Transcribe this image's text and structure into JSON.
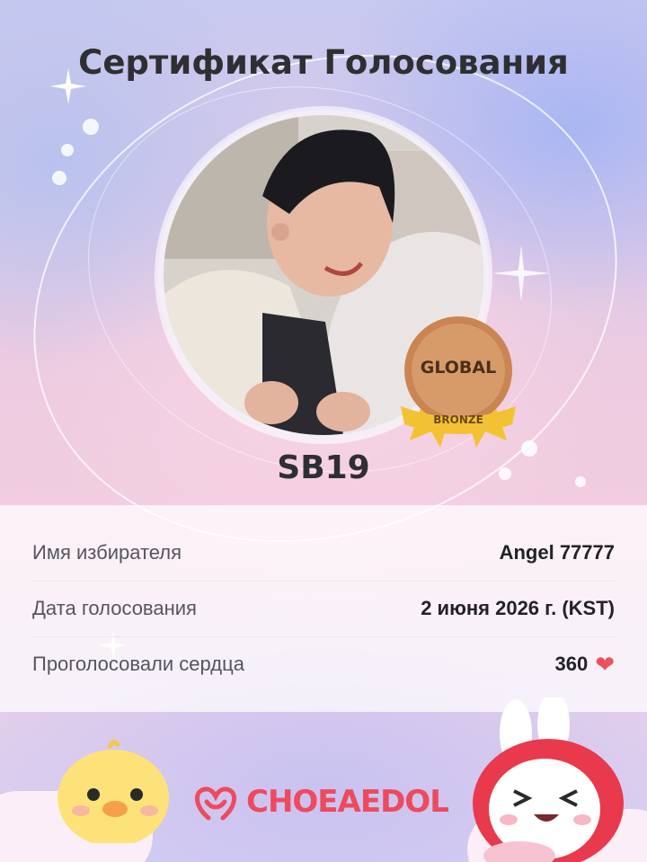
{
  "certificate": {
    "title": "Сертификат Голосования",
    "artist_name": "SB19",
    "badge": {
      "top_text": "GLOBAL",
      "ribbon_text": "BRONZE"
    }
  },
  "details": {
    "rows": [
      {
        "label": "Имя избирателя",
        "value": "Angel 77777"
      },
      {
        "label": "Дата голосования",
        "value": "2 июня 2026 г. (KST)"
      },
      {
        "label": "Проголосовали сердца",
        "value": "360"
      }
    ],
    "heart_icon": "heart-icon"
  },
  "brand": {
    "name": "CHOEAEDOL"
  },
  "colors": {
    "accent": "#ee4a5e",
    "heart": "#f0505e",
    "badge_bronze": "#d79b6a",
    "ribbon_gold": "#f2c233",
    "title": "#2f2f33"
  }
}
